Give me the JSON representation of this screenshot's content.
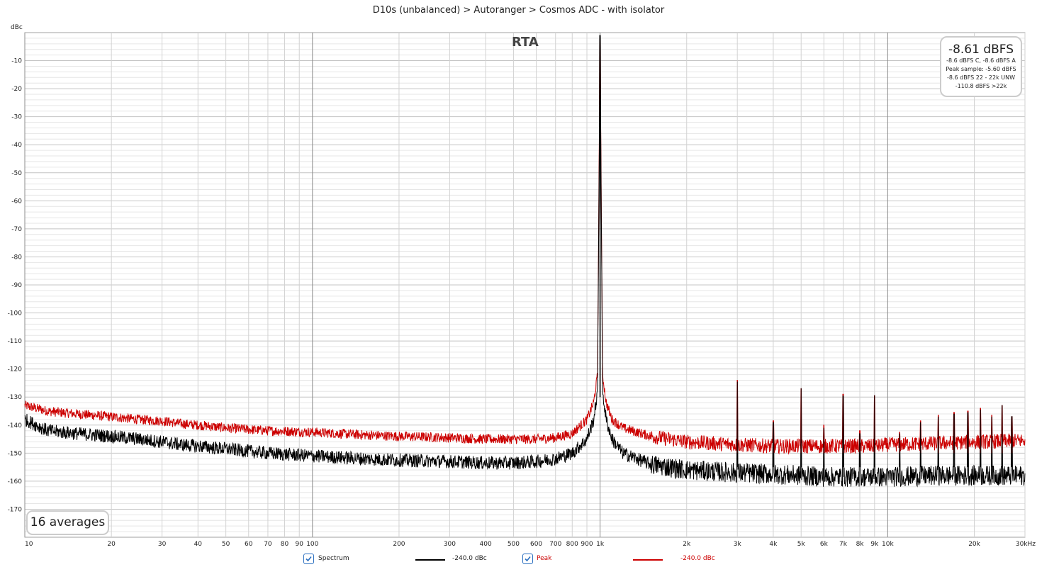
{
  "chart_data": {
    "type": "line",
    "title": "D10s (unbalanced) > Autoranger > Cosmos ADC - with isolator",
    "subtitle": "RTA",
    "ylabel": "dBc",
    "xlabel": "",
    "x_scale": "log",
    "xlim": [
      10,
      30000
    ],
    "ylim": [
      -180,
      0
    ],
    "y_ticks": [
      "-10",
      "-20",
      "-30",
      "-40",
      "-50",
      "-60",
      "-70",
      "-80",
      "-90",
      "-100",
      "-110",
      "-120",
      "-130",
      "-140",
      "-150",
      "-160",
      "-170"
    ],
    "x_ticks": [
      "10",
      "20",
      "30",
      "40",
      "50",
      "60",
      "70",
      "80",
      "90",
      "100",
      "200",
      "300",
      "400",
      "500",
      "600",
      "700",
      "800",
      "900",
      "1k",
      "2k",
      "3k",
      "4k",
      "5k",
      "6k",
      "7k",
      "8k",
      "9k",
      "10k",
      "20k",
      "30kHz"
    ],
    "grid": true,
    "series": [
      {
        "name": "Spectrum",
        "color": "#000000",
        "legend_value": "-240.0 dBc",
        "checked": true,
        "x": [
          10,
          12,
          15,
          20,
          25,
          30,
          35,
          40,
          50,
          70,
          100,
          150,
          200,
          300,
          400,
          500,
          600,
          700,
          800,
          900,
          950,
          980,
          1000,
          1020,
          1050,
          1100,
          1200,
          1500,
          2000,
          3000,
          4000,
          5000,
          6000,
          7000,
          8000,
          9000,
          10000,
          15000,
          20000,
          30000
        ],
        "values": [
          -138,
          -142,
          -143,
          -144,
          -145,
          -146,
          -147,
          -147.5,
          -148.5,
          -150,
          -151,
          -152,
          -152.5,
          -153,
          -153.5,
          -153.5,
          -153,
          -152,
          -150,
          -145,
          -138,
          -128,
          0,
          -128,
          -138,
          -145,
          -150,
          -154,
          -156,
          -157,
          -157.5,
          -158,
          -158.5,
          -158.5,
          -158.5,
          -158.5,
          -158.5,
          -158,
          -158,
          -158
        ]
      },
      {
        "name": "Peak",
        "color": "#cc0000",
        "legend_value": "-240.0 dBc",
        "checked": true,
        "x": [
          10,
          12,
          15,
          20,
          25,
          30,
          35,
          40,
          50,
          70,
          100,
          150,
          200,
          300,
          400,
          500,
          600,
          700,
          800,
          900,
          950,
          980,
          1000,
          1020,
          1050,
          1100,
          1200,
          1500,
          2000,
          3000,
          4000,
          5000,
          6000,
          7000,
          8000,
          9000,
          10000,
          15000,
          20000,
          30000
        ],
        "values": [
          -133,
          -135,
          -136,
          -137,
          -138,
          -138.5,
          -139.5,
          -140,
          -141,
          -142,
          -142.5,
          -143.5,
          -144,
          -144.5,
          -145,
          -145,
          -145,
          -144.5,
          -143,
          -138,
          -132,
          -122,
          0,
          -122,
          -132,
          -138,
          -141,
          -144,
          -146,
          -147,
          -147.5,
          -147.5,
          -147.5,
          -147.5,
          -147.5,
          -147.5,
          -147,
          -146.5,
          -146,
          -145.5
        ]
      }
    ],
    "harmonics": [
      {
        "x": 3000,
        "spectrum": -124.5,
        "peak": -124
      },
      {
        "x": 4000,
        "spectrum": -139,
        "peak": -138.5
      },
      {
        "x": 5000,
        "spectrum": -127,
        "peak": -127
      },
      {
        "x": 6000,
        "spectrum": -141,
        "peak": -140
      },
      {
        "x": 7000,
        "spectrum": -129.5,
        "peak": -129
      },
      {
        "x": 8000,
        "spectrum": -143,
        "peak": -142
      },
      {
        "x": 9000,
        "spectrum": -129.5,
        "peak": -129.5
      },
      {
        "x": 11000,
        "spectrum": -143,
        "peak": -142.5
      },
      {
        "x": 13000,
        "spectrum": -139,
        "peak": -138.5
      },
      {
        "x": 15000,
        "spectrum": -137,
        "peak": -136.5
      },
      {
        "x": 17000,
        "spectrum": -136,
        "peak": -135.5
      },
      {
        "x": 19000,
        "spectrum": -135.5,
        "peak": -135
      },
      {
        "x": 21000,
        "spectrum": -134.5,
        "peak": -134
      },
      {
        "x": 23000,
        "spectrum": -137,
        "peak": -136.5
      },
      {
        "x": 25000,
        "spectrum": -133,
        "peak": -133
      },
      {
        "x": 27000,
        "spectrum": -137,
        "peak": -137
      }
    ]
  },
  "level_box": {
    "main": "-8.61 dBFS",
    "lines": [
      "-8.6 dBFS C, -8.6 dBFS A",
      "Peak sample: -5.60 dBFS",
      "-8.6 dBFS 22 - 22k UNW",
      "-110.8 dBFS >22k"
    ]
  },
  "averages_label": "16 averages"
}
